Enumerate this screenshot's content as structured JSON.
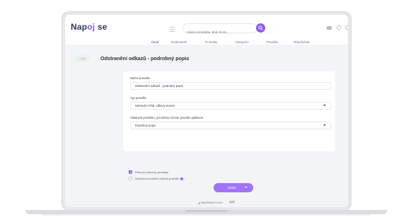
{
  "app": {
    "logo_text_prefix": "Nap",
    "logo_text_mid": "oj",
    "logo_text_suffix": " se"
  },
  "search": {
    "placeholder": "Název produktu, kód, EAN..."
  },
  "nav": {
    "items": [
      "Úvod",
      "Dodavatelé",
      "Produkty",
      "Kategorie",
      "Pravidla",
      "Objednávky"
    ]
  },
  "page": {
    "back_label": "‹ Zpět",
    "title": "Odstranění odkazů - podrobný popis"
  },
  "form": {
    "rule_name_label": "Název pravidla",
    "rule_name_value": "Odstranění odkazů - podrobný popis",
    "rule_type_label": "Typ pravidla",
    "rule_type_value": "Nahradit HTML odkazy textem",
    "property_label": "Vlastnost produktu, pro kterou chcete pravidlo aplikovat",
    "property_value": "Podrobný popis"
  },
  "options": {
    "all_products_label": "Platí pro všechny produkty",
    "all_products_checked": true,
    "freeze_label": "Zamezit provádění dalších pravidel",
    "freeze_checked": false
  },
  "actions": {
    "save_label": "Uložit",
    "back_link": "Zpět"
  },
  "footer": {
    "brand": "◢ SEOPRAKTICKY"
  },
  "colors": {
    "accent": "#8a5cf6",
    "save_button": "#a173f5",
    "back_button_bg": "#e8f3ee"
  }
}
